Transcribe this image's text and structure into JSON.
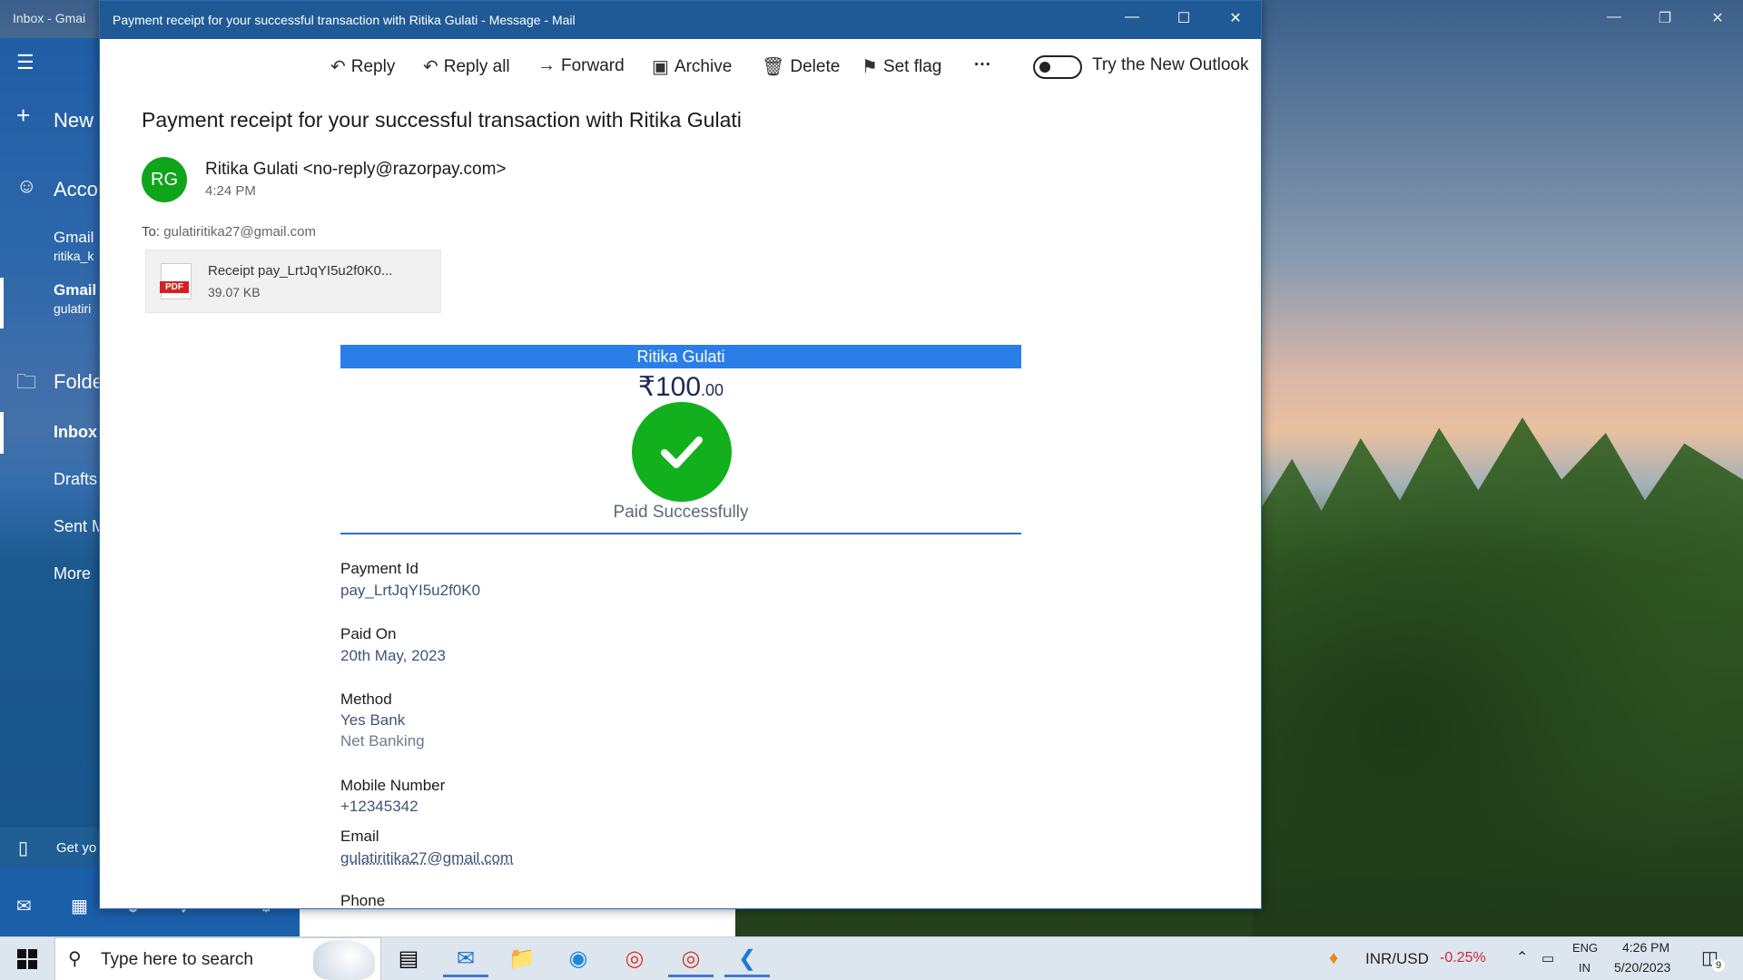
{
  "background_window": {
    "title": "Inbox - Gmai",
    "sidebar": {
      "new_label": "New",
      "accounts_label": "Acco",
      "account1": {
        "name": "Gmail",
        "email": "ritika_k"
      },
      "account2": {
        "name": "Gmail",
        "email": "gulatiri"
      },
      "folders_label": "Folde",
      "folders": [
        "Inbox",
        "Drafts",
        "Sent M",
        "More"
      ],
      "get_label": "Get yo"
    }
  },
  "message_window": {
    "title": "Payment receipt for your successful transaction with Ritika Gulati - Message - Mail",
    "toolbar": {
      "reply": "Reply",
      "reply_all": "Reply all",
      "forward": "Forward",
      "archive": "Archive",
      "delete": "Delete",
      "set_flag": "Set flag",
      "more": "···",
      "try_outlook": "Try the New Outlook"
    },
    "subject": "Payment receipt for your successful transaction with Ritika Gulati",
    "sender": {
      "initials": "RG",
      "display": "Ritika Gulati <no-reply@razorpay.com>",
      "time": "4:24 PM",
      "avatar_color": "#10a41b"
    },
    "to_label": "To:",
    "to_address": "gulatiritika27@gmail.com",
    "attachment": {
      "type_tag": "PDF",
      "name": "Receipt pay_LrtJqYI5u2f0K0...",
      "size": "39.07 KB"
    },
    "receipt": {
      "merchant": "Ritika Gulati",
      "amount_main": "₹100",
      "amount_decimal": ".00",
      "status": "Paid Successfully",
      "accent_color": "#2b7ee8",
      "fields": {
        "payment_id_label": "Payment Id",
        "payment_id": "pay_LrtJqYI5u2f0K0",
        "paid_on_label": "Paid On",
        "paid_on": "20th May, 2023",
        "method_label": "Method",
        "method_bank": "Yes Bank",
        "method_type": "Net Banking",
        "mobile_label": "Mobile Number",
        "mobile": "+12345342",
        "email_label": "Email",
        "email": "gulatiritika27@gmail.com",
        "phone_label": "Phone"
      }
    }
  },
  "taskbar": {
    "search_placeholder": "Type here to search",
    "currency": "INR/USD",
    "currency_change": "-0.25%",
    "lang_top": "ENG",
    "lang_bottom": "IN",
    "time": "4:26 PM",
    "date": "5/20/2023",
    "notif_count": "9"
  }
}
